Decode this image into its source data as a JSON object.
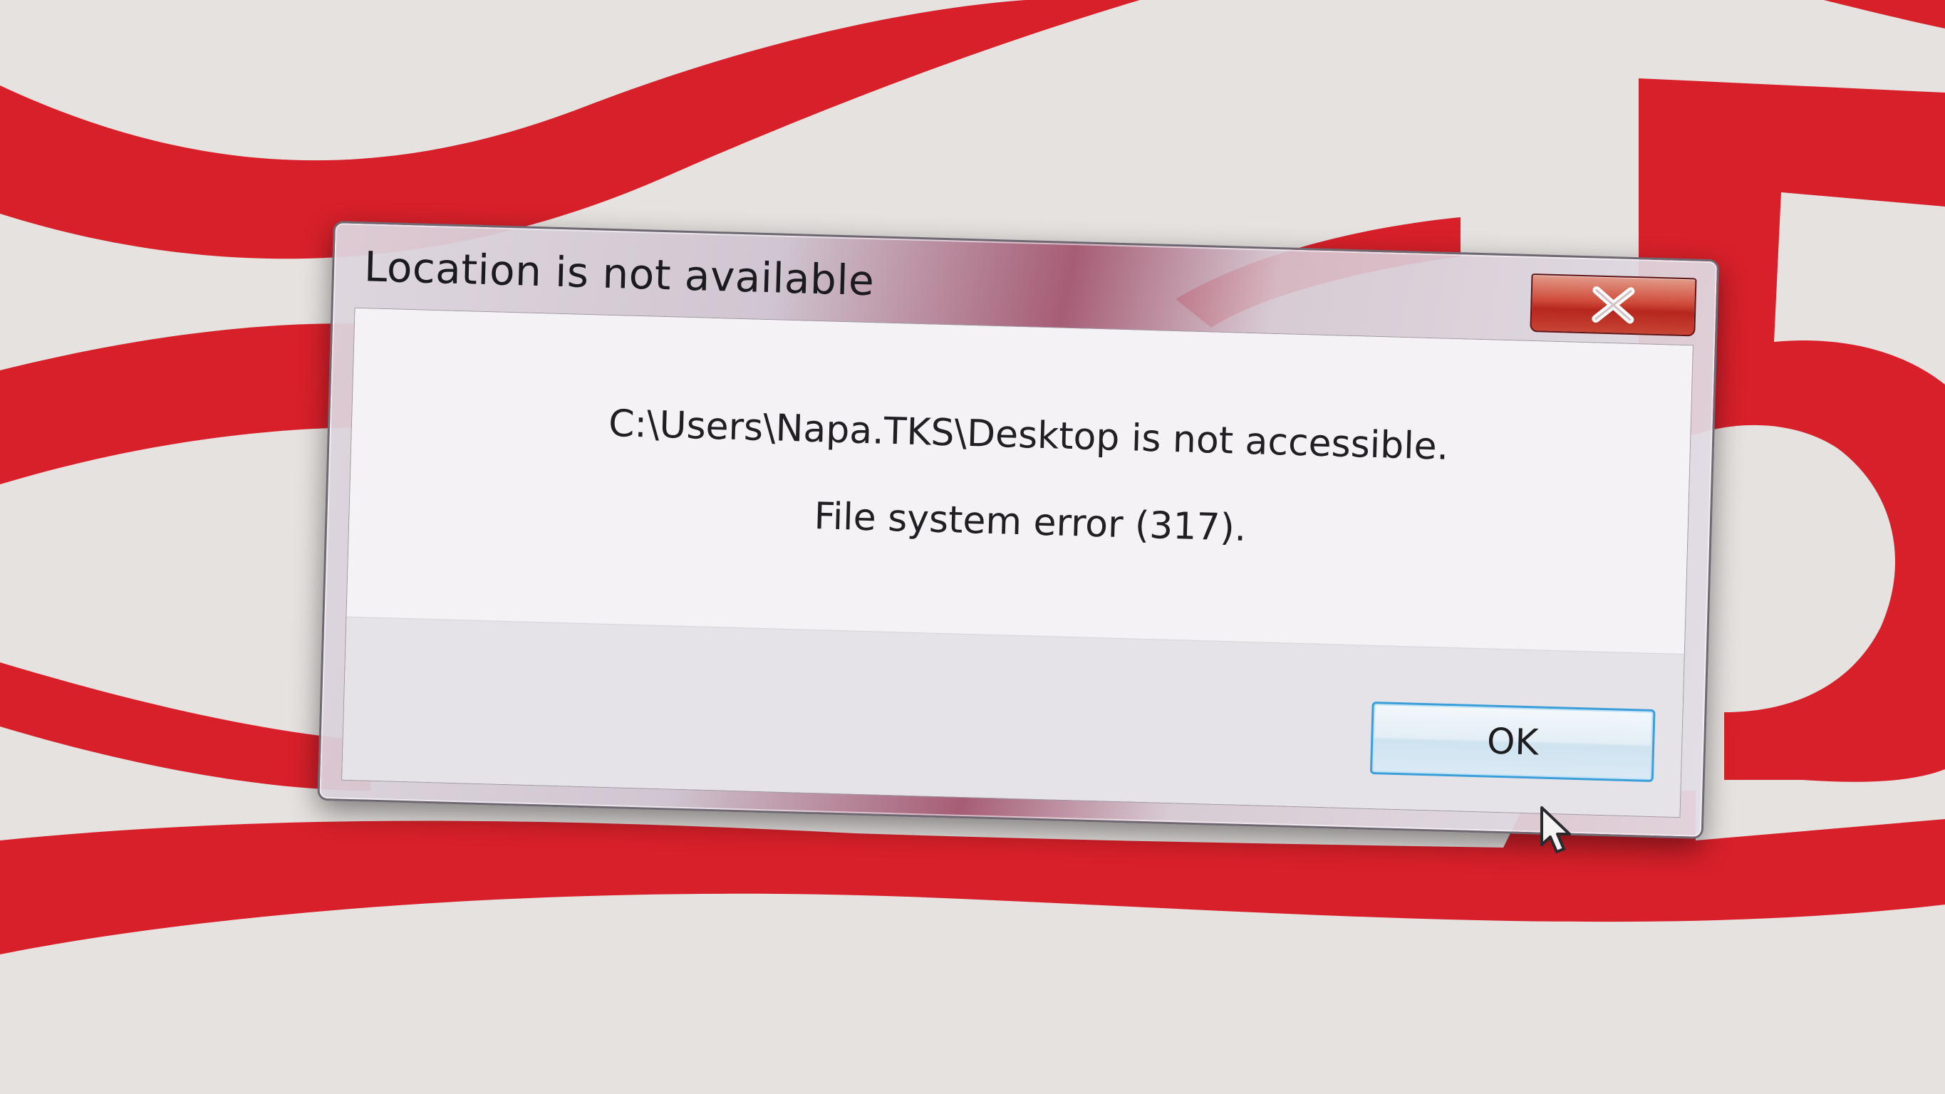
{
  "dialog": {
    "title": "Location is not available",
    "close_icon": "close-icon",
    "message_line_1": "C:\\Users\\Napa.TKS\\Desktop is not accessible.",
    "message_line_2": "File system error (317).",
    "ok_label": "OK"
  },
  "desktop": {
    "wallpaper_colors": {
      "red": "#d8202a",
      "background": "#e8e4e2"
    }
  },
  "pointer": {
    "icon": "mouse-pointer-icon"
  }
}
